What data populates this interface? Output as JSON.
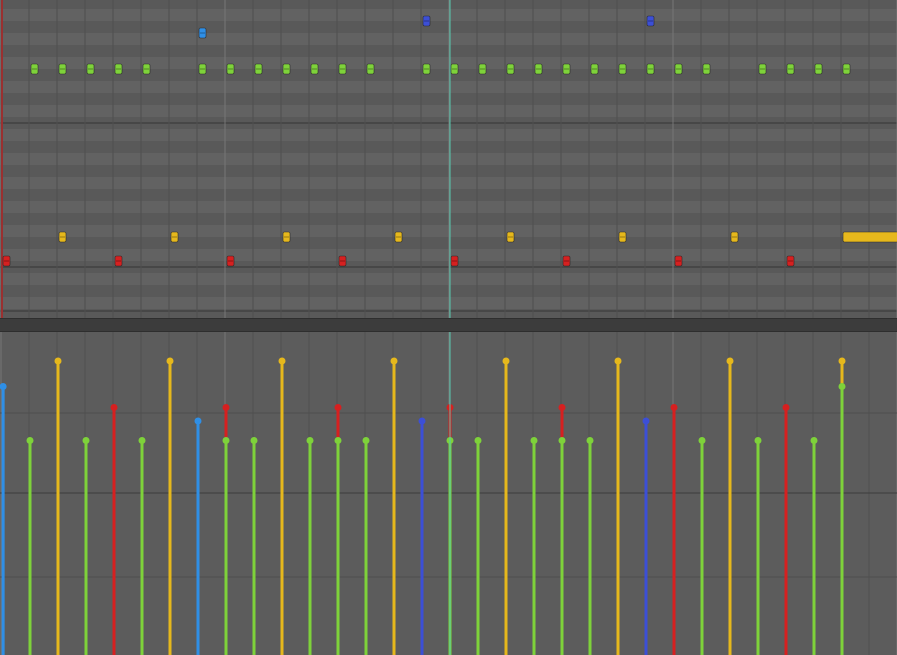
{
  "editor": {
    "view": "piano-roll",
    "colors": {
      "green": "#7ed23a",
      "yellow": "#e6b81c",
      "red": "#d62020",
      "light_blue": "#2f8fe6",
      "dark_blue": "#3c4fd6",
      "playhead": "#57c9b0",
      "loop_marker": "#9a3030"
    },
    "playhead_beat": 16,
    "notes": [
      {
        "row": "hihat",
        "color": "green",
        "beats": [
          1,
          2,
          3,
          4,
          5,
          7,
          8,
          9,
          10,
          11,
          12,
          13,
          15,
          16,
          17,
          18,
          19,
          20,
          21,
          22,
          23,
          24,
          25,
          27,
          28,
          29,
          30
        ]
      },
      {
        "row": "tom",
        "color": "light_blue",
        "beats": [
          7
        ]
      },
      {
        "row": "crash",
        "color": "dark_blue",
        "beats": [
          15,
          23
        ]
      },
      {
        "row": "snare",
        "color": "yellow",
        "beats": [
          2,
          6,
          10,
          14,
          18,
          22,
          26
        ]
      },
      {
        "row": "snare",
        "color": "yellow",
        "long_note": {
          "start": 30,
          "length_beats": 2
        }
      },
      {
        "row": "kick",
        "color": "red",
        "beats": [
          0,
          4,
          8,
          12,
          16,
          20,
          24,
          28
        ]
      }
    ],
    "velocity_lane": {
      "stems": [
        {
          "beat": 0.04,
          "color": "light_blue",
          "level": 0.83
        },
        {
          "beat": 7,
          "color": "light_blue",
          "level": 0.6
        },
        {
          "beat": 15,
          "color": "dark_blue",
          "level": 0.6
        },
        {
          "beat": 23,
          "color": "dark_blue",
          "level": 0.6
        },
        {
          "beat": 2,
          "color": "yellow",
          "level": 1.0
        },
        {
          "beat": 6,
          "color": "yellow",
          "level": 1.0
        },
        {
          "beat": 10,
          "color": "yellow",
          "level": 1.0
        },
        {
          "beat": 14,
          "color": "yellow",
          "level": 1.0
        },
        {
          "beat": 18,
          "color": "yellow",
          "level": 1.0
        },
        {
          "beat": 22,
          "color": "yellow",
          "level": 1.0
        },
        {
          "beat": 26,
          "color": "yellow",
          "level": 1.0
        },
        {
          "beat": 30,
          "color": "yellow",
          "level": 1.0
        },
        {
          "beat": 4,
          "color": "red",
          "level": 0.69
        },
        {
          "beat": 8,
          "color": "red",
          "level": 0.69
        },
        {
          "beat": 12,
          "color": "red",
          "level": 0.69
        },
        {
          "beat": 16,
          "color": "red",
          "level": 0.69
        },
        {
          "beat": 20,
          "color": "red",
          "level": 0.69
        },
        {
          "beat": 24,
          "color": "red",
          "level": 0.69
        },
        {
          "beat": 28,
          "color": "red",
          "level": 0.69
        },
        {
          "beat": 1,
          "color": "green",
          "level": 0.47
        },
        {
          "beat": 3,
          "color": "green",
          "level": 0.47
        },
        {
          "beat": 5,
          "color": "green",
          "level": 0.47
        },
        {
          "beat": 8,
          "color": "green",
          "level": 0.47
        },
        {
          "beat": 9,
          "color": "green",
          "level": 0.47
        },
        {
          "beat": 11,
          "color": "green",
          "level": 0.47
        },
        {
          "beat": 12,
          "color": "green",
          "level": 0.47
        },
        {
          "beat": 13,
          "color": "green",
          "level": 0.47
        },
        {
          "beat": 16,
          "color": "green",
          "level": 0.47
        },
        {
          "beat": 17,
          "color": "green",
          "level": 0.47
        },
        {
          "beat": 19,
          "color": "green",
          "level": 0.47
        },
        {
          "beat": 20,
          "color": "green",
          "level": 0.47
        },
        {
          "beat": 21,
          "color": "green",
          "level": 0.47
        },
        {
          "beat": 25,
          "color": "green",
          "level": 0.47
        },
        {
          "beat": 27,
          "color": "green",
          "level": 0.47
        },
        {
          "beat": 29,
          "color": "green",
          "level": 0.47
        },
        {
          "beat": 30,
          "color": "green",
          "level": 0.83
        }
      ]
    }
  }
}
